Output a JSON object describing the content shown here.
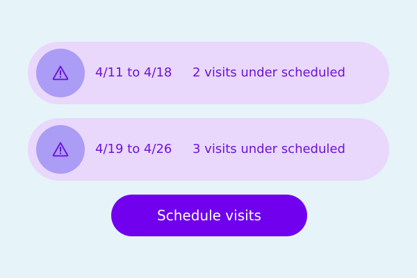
{
  "colors": {
    "background": "#e6f3f9",
    "row_background": "#e9d8fb",
    "icon_circle": "#ab9cf6",
    "accent_text": "#6d12d8",
    "button_background": "#7000ee",
    "button_text": "#ffffff"
  },
  "alerts": [
    {
      "icon": "warning-triangle-icon",
      "date_range": "4/11 to 4/18",
      "status": "2 visits under scheduled"
    },
    {
      "icon": "warning-triangle-icon",
      "date_range": "4/19 to 4/26",
      "status": "3 visits under scheduled"
    }
  ],
  "action": {
    "label": "Schedule visits"
  }
}
